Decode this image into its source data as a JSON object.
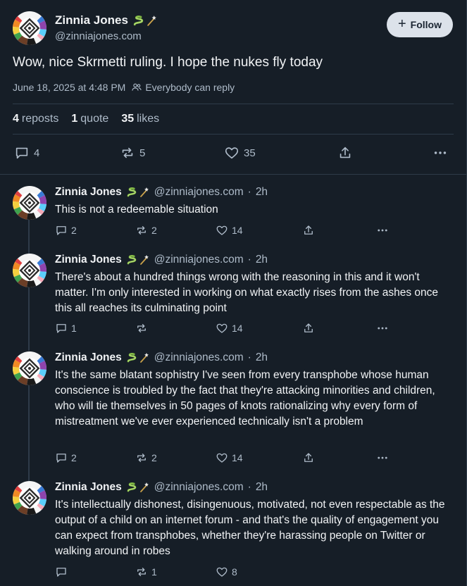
{
  "post": {
    "author_name": "Zinnia Jones",
    "author_emoji": [
      "snake-emoji",
      "wand-emoji"
    ],
    "author_handle": "@zinniajones.com",
    "follow_label": "Follow",
    "text": "Wow, nice Skrmetti ruling. I hope the nukes fly today",
    "timestamp": "June 18, 2025 at 4:48 PM",
    "reply_setting": "Everybody can reply",
    "stats": {
      "reposts_count": "4",
      "reposts_label": "reposts",
      "quotes_count": "1",
      "quotes_label": "quote",
      "likes_count": "35",
      "likes_label": "likes"
    },
    "actions": {
      "replies": "4",
      "reposts": "5",
      "likes": "35"
    }
  },
  "replies": [
    {
      "author_name": "Zinnia Jones",
      "author_handle": "@zinniajones.com",
      "separator": "·",
      "time": "2h",
      "text": "This is not a redeemable situation",
      "replies": "2",
      "reposts": "2",
      "likes": "14"
    },
    {
      "author_name": "Zinnia Jones",
      "author_handle": "@zinniajones.com",
      "separator": "·",
      "time": "2h",
      "text": "There's about a hundred things wrong with the reasoning in this and it won't matter. I'm only interested in working on what exactly rises from the ashes once this all reaches its culminating point",
      "replies": "1",
      "reposts": "",
      "likes": "14"
    },
    {
      "author_name": "Zinnia Jones",
      "author_handle": "@zinniajones.com",
      "separator": "·",
      "time": "2h",
      "text": "It's the same blatant sophistry I've seen from every transphobe whose human conscience is troubled by the fact that they're attacking minorities and children, who will tie themselves in 50 pages of knots rationalizing why every form of mistreatment we've ever experienced technically isn't a problem",
      "replies": "2",
      "reposts": "2",
      "likes": "14"
    },
    {
      "author_name": "Zinnia Jones",
      "author_handle": "@zinniajones.com",
      "separator": "·",
      "time": "2h",
      "text": "It's intellectually dishonest, disingenuous, motivated, not even respectable as the output of a child on an internet forum - and that's the quality of engagement you can expect from transphobes, whether they're harassing people on Twitter or walking around in robes",
      "replies": "",
      "reposts": "1",
      "likes": "8"
    }
  ],
  "colors": {
    "background": "#161e27",
    "text": "#f1f3f5",
    "muted": "#aebbc9",
    "divider": "#2e3b49",
    "follow_bg": "#dce2ea"
  }
}
